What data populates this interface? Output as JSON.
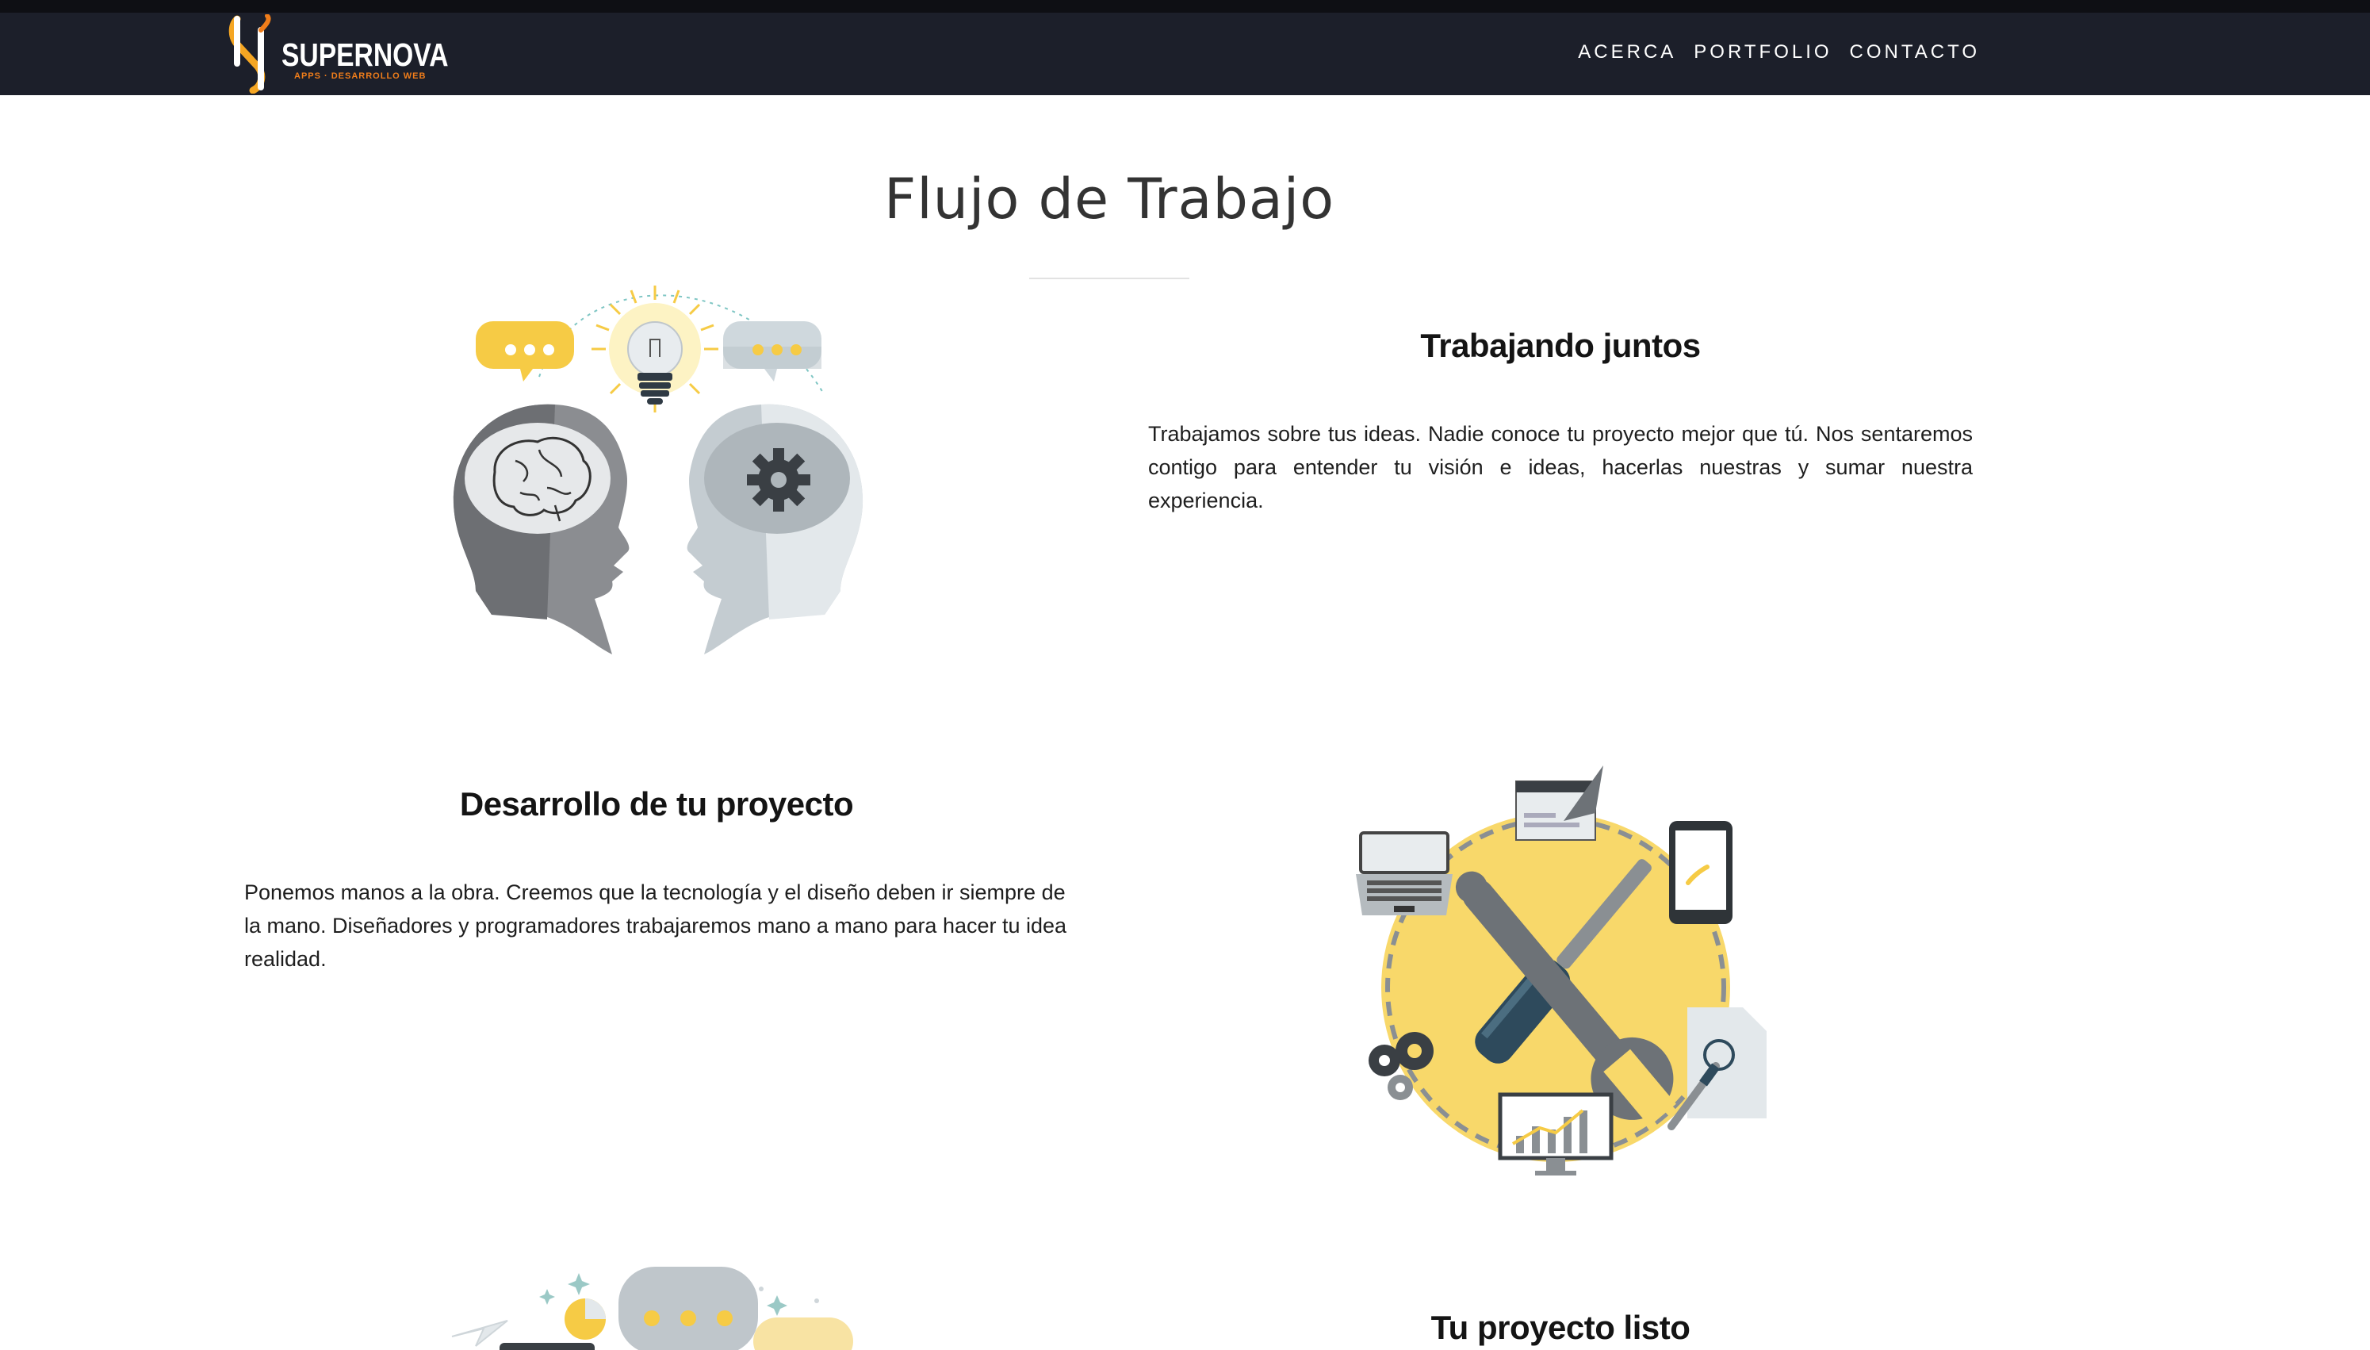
{
  "navbar": {
    "brand": "SUPERNOVA",
    "tagline": "APPS · DESARROLLO WEB",
    "links": [
      "ACERCA",
      "PORTFOLIO",
      "CONTACTO"
    ],
    "colors": {
      "background": "#1c1f2a",
      "logo_accent": "#f5a623",
      "tagline": "#f07d1a"
    }
  },
  "section": {
    "title": "Flujo de Trabajo"
  },
  "blocks": [
    {
      "heading": "Trabajando juntos",
      "text": "Trabajamos sobre tus ideas. Nadie conoce tu proyecto mejor que tú. Nos sentaremos contigo para entender tu visión e ideas, hacerlas nuestras y sumar nuestra experiencia.",
      "icon": "two-heads-brain-gear-illustration"
    },
    {
      "heading": "Desarrollo de tu proyecto",
      "text": "Ponemos manos a la obra. Creemos que la tecnología y el diseño deben ir siempre de la mano. Diseñadores y programadores trabajaremos mano a mano para hacer tu idea realidad.",
      "icon": "tools-development-illustration"
    },
    {
      "heading": "Tu proyecto listo",
      "icon": "launch-chat-illustration"
    }
  ]
}
